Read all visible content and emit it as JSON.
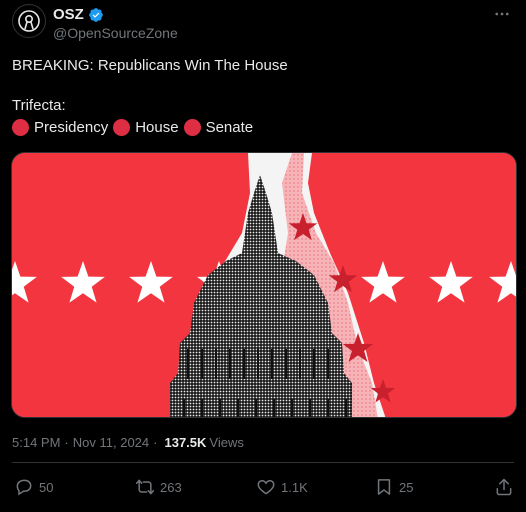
{
  "author": {
    "display_name": "OSZ",
    "handle": "@OpenSourceZone",
    "verified": true,
    "avatar_icon": "osz-logo-icon"
  },
  "tweet": {
    "line1": "BREAKING: Republicans Win The House",
    "line2": "Trifecta:",
    "trifecta": [
      "Presidency",
      "House",
      "Senate"
    ],
    "dot_color": "#dd2e44"
  },
  "media": {
    "description_icon": "capitol-dome-image",
    "background_color": "#f2353f"
  },
  "meta": {
    "time": "5:14 PM",
    "separator": "·",
    "date": "Nov 11, 2024",
    "separator2": "·",
    "views_count": "137.5K",
    "views_label": "Views"
  },
  "actions": {
    "replies": "50",
    "reposts": "263",
    "likes": "1.1K",
    "bookmarks": "25"
  },
  "colors": {
    "background": "#000000",
    "text": "#e7e9ea",
    "muted": "#71767b",
    "verified": "#1d9bf0"
  }
}
